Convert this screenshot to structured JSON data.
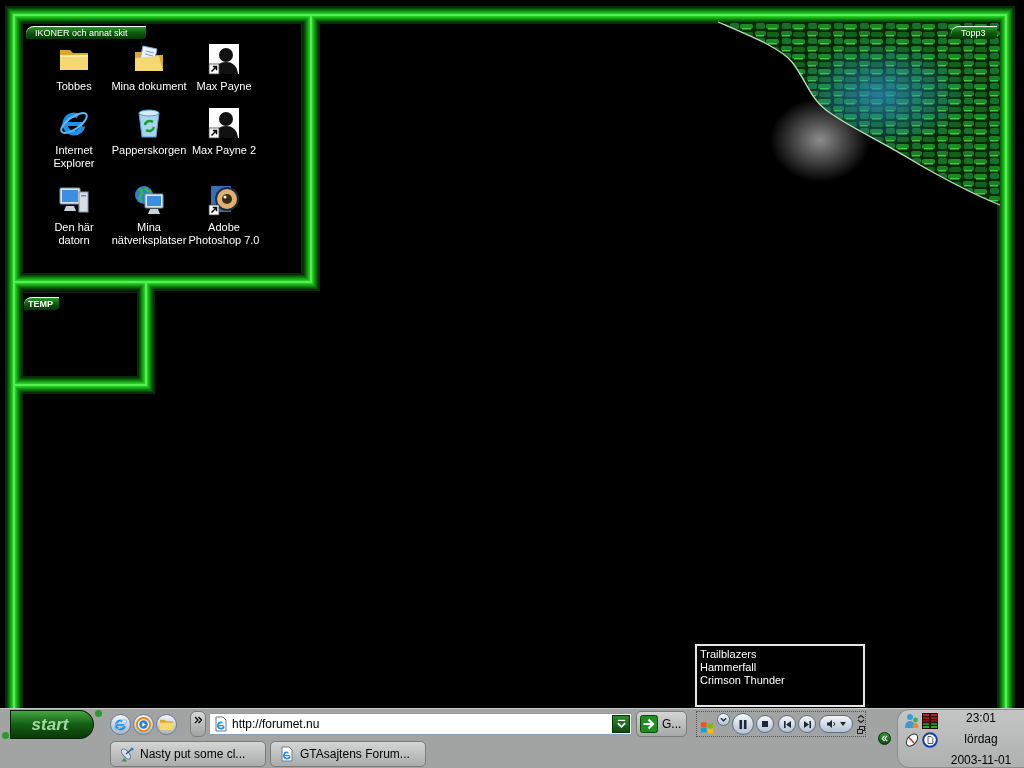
{
  "desktop": {
    "panels": [
      {
        "label": "IKONER och annat skit"
      },
      {
        "label": "TEMP"
      },
      {
        "label": "Topp3"
      }
    ],
    "icons": [
      {
        "label": "Tobbes",
        "kind": "folder",
        "shortcut": false
      },
      {
        "label": "Mina dokument",
        "kind": "documents",
        "shortcut": false
      },
      {
        "label": "Max Payne",
        "kind": "portrait",
        "shortcut": true
      },
      {
        "label": "Internet Explorer",
        "kind": "browser",
        "shortcut": false
      },
      {
        "label": "Papperskorgen",
        "kind": "recycle",
        "shortcut": false
      },
      {
        "label": "Max Payne 2",
        "kind": "portrait",
        "shortcut": true
      },
      {
        "label": "Den här datorn",
        "kind": "computer",
        "shortcut": false
      },
      {
        "label": "Mina nätverksplatser",
        "kind": "network",
        "shortcut": false
      },
      {
        "label": "Adobe Photoshop 7.0",
        "kind": "photoshop",
        "shortcut": true
      }
    ]
  },
  "now_playing": {
    "title": "Trailblazers",
    "artist": "Hammerfall",
    "album": "Crimson Thunder"
  },
  "taskbar": {
    "start": {
      "label": "start"
    },
    "address": {
      "value": "http://forumet.nu"
    },
    "go": {
      "label": "G..."
    },
    "tasks": [
      {
        "label": "Nasty put some cl...",
        "kind": "chat"
      },
      {
        "label": "GTAsajtens Forum...",
        "kind": "browser"
      }
    ],
    "clock": {
      "time": "23:01",
      "day": "lördag",
      "date": "2003-11-01"
    }
  }
}
